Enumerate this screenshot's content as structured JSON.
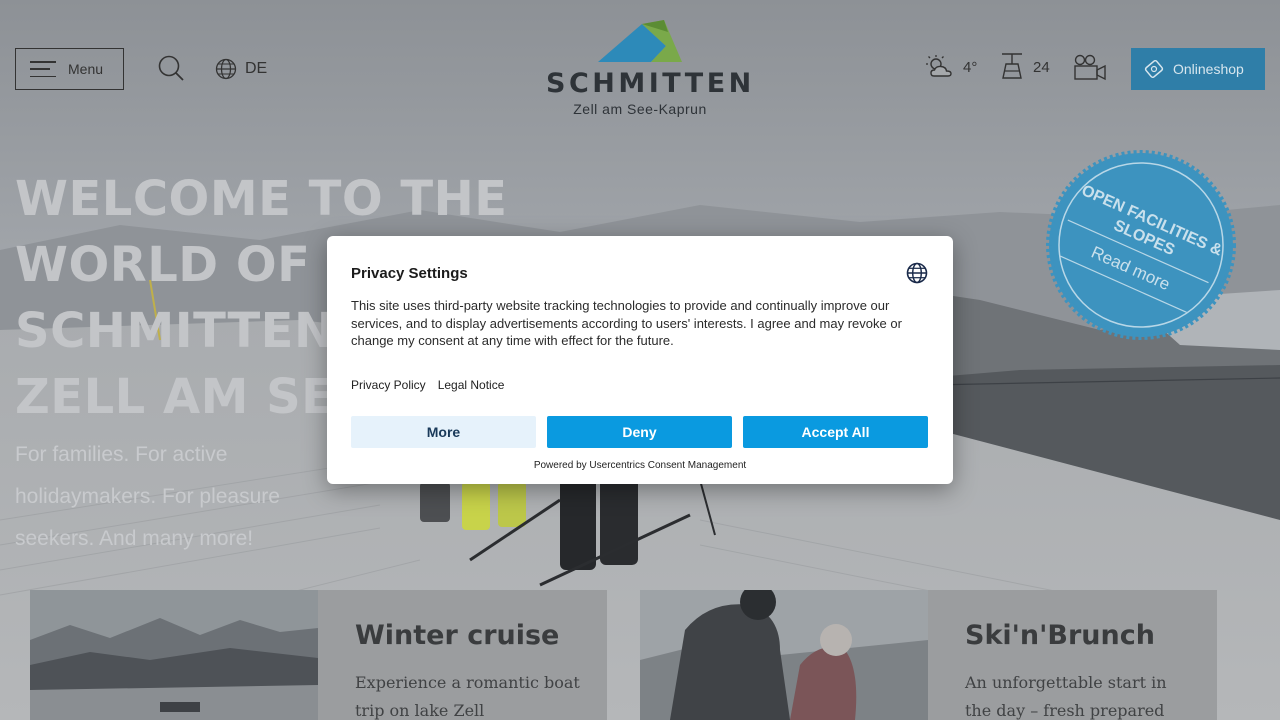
{
  "header": {
    "menu_label": "Menu",
    "language": "DE",
    "logo_word": "SCHMITTEN",
    "logo_sub": "Zell am See-Kaprun",
    "weather": "4°",
    "open_lifts": "24",
    "onlineshop_label": "Onlineshop"
  },
  "hero": {
    "title_lines": [
      "WELCOME TO THE",
      "WORLD OF THE",
      "SCHMITTEN",
      "ZELL AM SEE"
    ],
    "subtitle": "For families. For active holidaymakers. For pleasure seekers. And many more!"
  },
  "stamp": {
    "line1": "OPEN FACILITIES &",
    "line2": "SLOPES",
    "line3": "Read more"
  },
  "cards": [
    {
      "title": "Winter cruise",
      "text": "Experience a romantic boat trip on lake Zell"
    },
    {
      "title": "Ski'n'Brunch",
      "text": "An unforgettable start in the day – fresh prepared slopes"
    }
  ],
  "consent": {
    "title": "Privacy Settings",
    "body": "This site uses third-party website tracking technologies to provide and continually improve our services, and to display advertisements according to users' interests. I agree and may revoke or change my consent at any time with effect for the future.",
    "privacy_policy": "Privacy Policy",
    "legal_notice": "Legal Notice",
    "more_label": "More",
    "deny_label": "Deny",
    "accept_label": "Accept All",
    "powered_by": "Powered by Usercentrics Consent Management"
  },
  "colors": {
    "accent_blue": "#0a9ae0",
    "shop_blue": "#2f7ea8",
    "stamp_blue": "#3d93bf"
  }
}
